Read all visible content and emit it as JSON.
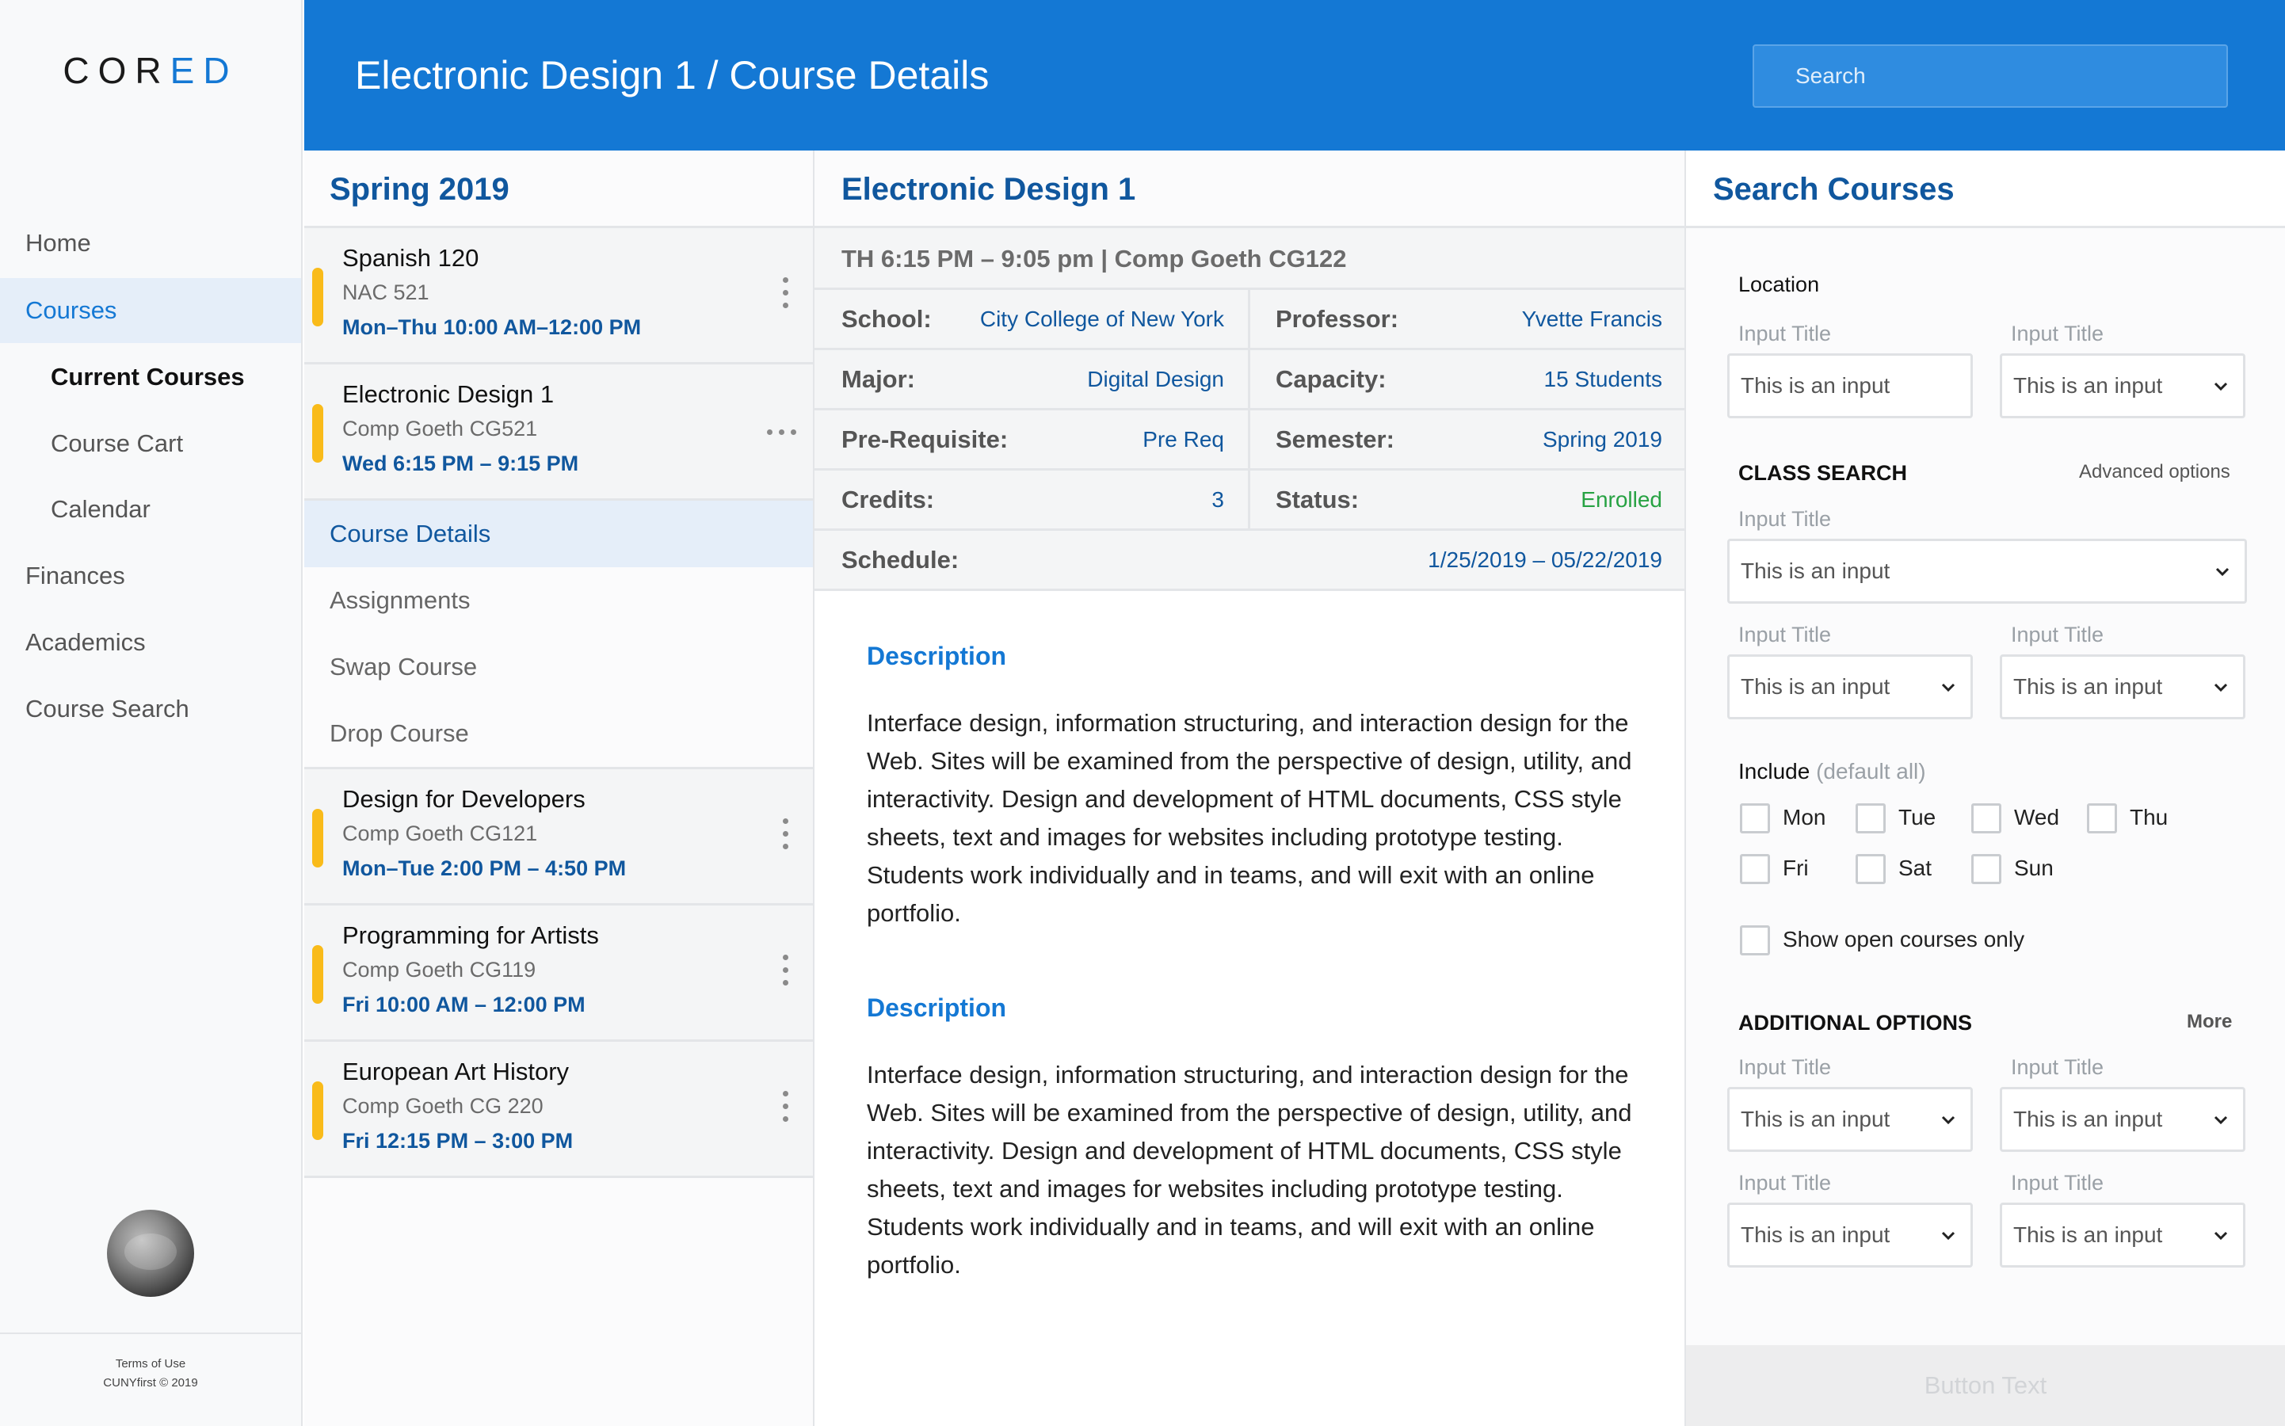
{
  "app": {
    "logo_prefix": "COR",
    "logo_accent": "ED",
    "accent_color": "#1478d4",
    "dark_accent_color": "#10579e",
    "course_marker_color": "#f9bb1a",
    "status_color": "#27a243"
  },
  "sidebar": {
    "items": [
      {
        "label": "Home"
      },
      {
        "label": "Courses"
      },
      {
        "label": "Current Courses"
      },
      {
        "label": "Course Cart"
      },
      {
        "label": "Calendar"
      },
      {
        "label": "Finances"
      },
      {
        "label": "Academics"
      },
      {
        "label": "Course Search"
      }
    ],
    "footer_terms": "Terms of Use",
    "footer_copyright": "CUNYfirst © 2019"
  },
  "header": {
    "title": "Electronic Design 1 / Course Details",
    "search_placeholder": "Search"
  },
  "term": {
    "title": "Spring 2019",
    "courses": [
      {
        "name": "Spanish 120",
        "room": "NAC 521",
        "time": "Mon–Thu 10:00 AM–12:00 PM",
        "menu_icon": "kebab-icon"
      },
      {
        "name": "Electronic Design 1",
        "room": "Comp Goeth  CG521",
        "time": "Wed 6:15 PM – 9:15 PM",
        "menu_icon": "more-horizontal-icon"
      },
      {
        "name": "Design for Developers",
        "room": "Comp Goeth CG121",
        "time": "Mon–Tue 2:00 PM – 4:50 PM",
        "menu_icon": "kebab-icon"
      },
      {
        "name": "Programming for Artists",
        "room": "Comp Goeth CG119",
        "time": "Fri 10:00 AM – 12:00 PM",
        "menu_icon": "kebab-icon"
      },
      {
        "name": "European Art History",
        "room": "Comp Goeth CG 220",
        "time": "Fri 12:15 PM – 3:00 PM",
        "menu_icon": "kebab-icon"
      }
    ],
    "subnav": [
      {
        "label": "Course Details"
      },
      {
        "label": "Assignments"
      },
      {
        "label": "Swap Course"
      },
      {
        "label": "Drop Course"
      }
    ]
  },
  "detail": {
    "title": "Electronic Design 1",
    "meeting": "TH 6:15 PM – 9:05 pm | Comp Goeth CG122",
    "rows": [
      {
        "left_label": "School:",
        "left_value": "City College of New York",
        "right_label": "Professor:",
        "right_value": "Yvette Francis"
      },
      {
        "left_label": "Major:",
        "left_value": "Digital Design",
        "right_label": "Capacity:",
        "right_value": "15 Students"
      },
      {
        "left_label": "Pre-Requisite:",
        "left_value": "Pre Req",
        "right_label": "Semester:",
        "right_value": "Spring 2019"
      },
      {
        "left_label": "Credits:",
        "left_value": "3",
        "right_label": "Status:",
        "right_value": "Enrolled"
      }
    ],
    "schedule_label": "Schedule:",
    "schedule_value": "1/25/2019 – 05/22/2019",
    "descriptions": [
      {
        "title": "Description",
        "text": "Interface design, information structuring, and interaction design for the Web. Sites will be examined from the perspective of design, utility, and interactivity. Design and development of HTML documents, CSS style sheets, text and images for websites including prototype testing. Students work individually and in teams, and will exit with an online portfolio."
      },
      {
        "title": "Description",
        "text": "Interface design, information structuring, and interaction design for the Web. Sites will be examined from the perspective of design, utility, and interactivity. Design and development of HTML documents, CSS style sheets, text and images for websites including prototype testing. Students work individually and in teams, and will exit with an online portfolio."
      }
    ]
  },
  "search": {
    "title": "Search Courses",
    "location_label": "Location",
    "input_title": "Input Title",
    "input_value": "This is an input",
    "class_search_label": "CLASS SEARCH",
    "advanced_label": "Advanced options",
    "include_label": "Include",
    "include_default": "(default all)",
    "days": [
      "Mon",
      "Tue",
      "Wed",
      "Thu",
      "Fri",
      "Sat",
      "Sun"
    ],
    "open_only_label": "Show open courses only",
    "additional_label": "ADDITIONAL OPTIONS",
    "more_label": "More",
    "button_text": "Button Text"
  }
}
